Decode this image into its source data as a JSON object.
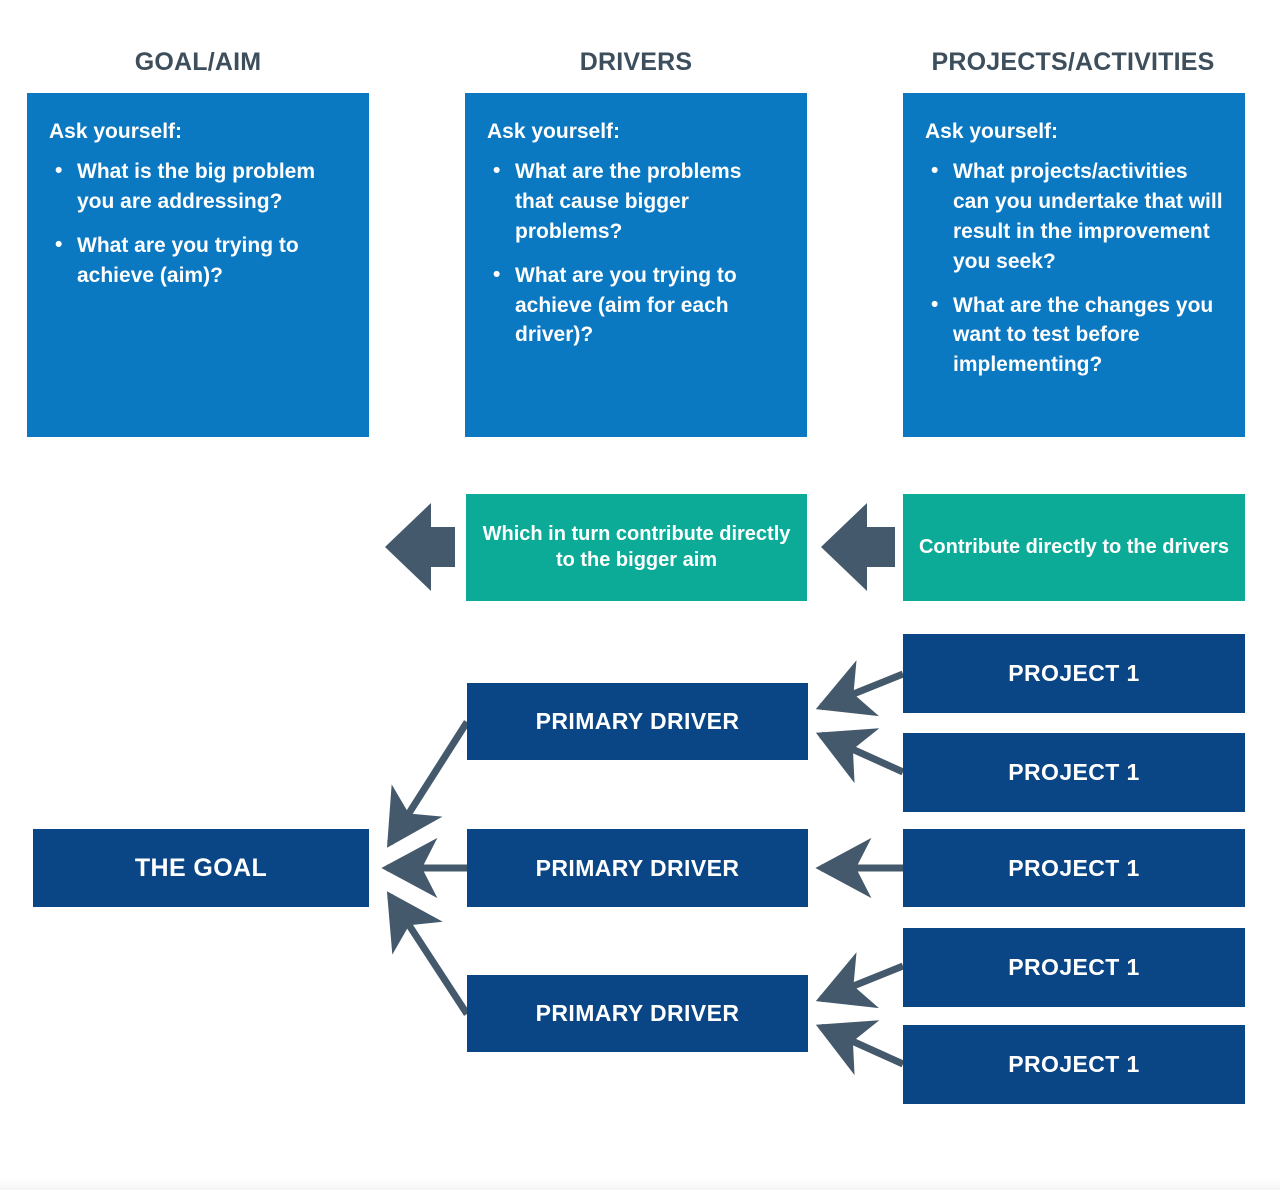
{
  "columns": [
    {
      "title": "GOAL/AIM"
    },
    {
      "title": "DRIVERS"
    },
    {
      "title": "PROJECTS/ACTIVITIES"
    }
  ],
  "info_cards": [
    {
      "lead": "Ask yourself:",
      "bullets": [
        "What is the big problem you are addressing?",
        "What are you trying to achieve (aim)?"
      ]
    },
    {
      "lead": "Ask yourself:",
      "bullets": [
        "What are the problems that cause bigger problems?",
        "What are you trying to achieve (aim for each driver)?"
      ]
    },
    {
      "lead": "Ask yourself:",
      "bullets": [
        "What projects/activities can you undertake that will result in the improvement you seek?",
        "What are the changes you want to test before implementing?"
      ]
    }
  ],
  "banners": [
    {
      "text": "Which in turn contribute directly to the bigger aim"
    },
    {
      "text": "Contribute directly to the drivers"
    }
  ],
  "nodes": {
    "goal": {
      "label": "THE GOAL"
    },
    "drivers": [
      {
        "label": "PRIMARY DRIVER"
      },
      {
        "label": "PRIMARY DRIVER"
      },
      {
        "label": "PRIMARY DRIVER"
      }
    ],
    "projects": [
      {
        "label": "PROJECT 1"
      },
      {
        "label": "PROJECT 1"
      },
      {
        "label": "PROJECT 1"
      },
      {
        "label": "PROJECT 1"
      },
      {
        "label": "PROJECT 1"
      }
    ]
  },
  "colors": {
    "header_text": "#3d4e5c",
    "info_card": "#0b78c2",
    "banner": "#0cab98",
    "node": "#0a4685",
    "arrow": "#44596b",
    "page_background": "#ffffff"
  },
  "icons": {
    "block_arrow_left": "block-arrow-left-icon",
    "connector_arrow": "connector-arrow-left-icon"
  }
}
